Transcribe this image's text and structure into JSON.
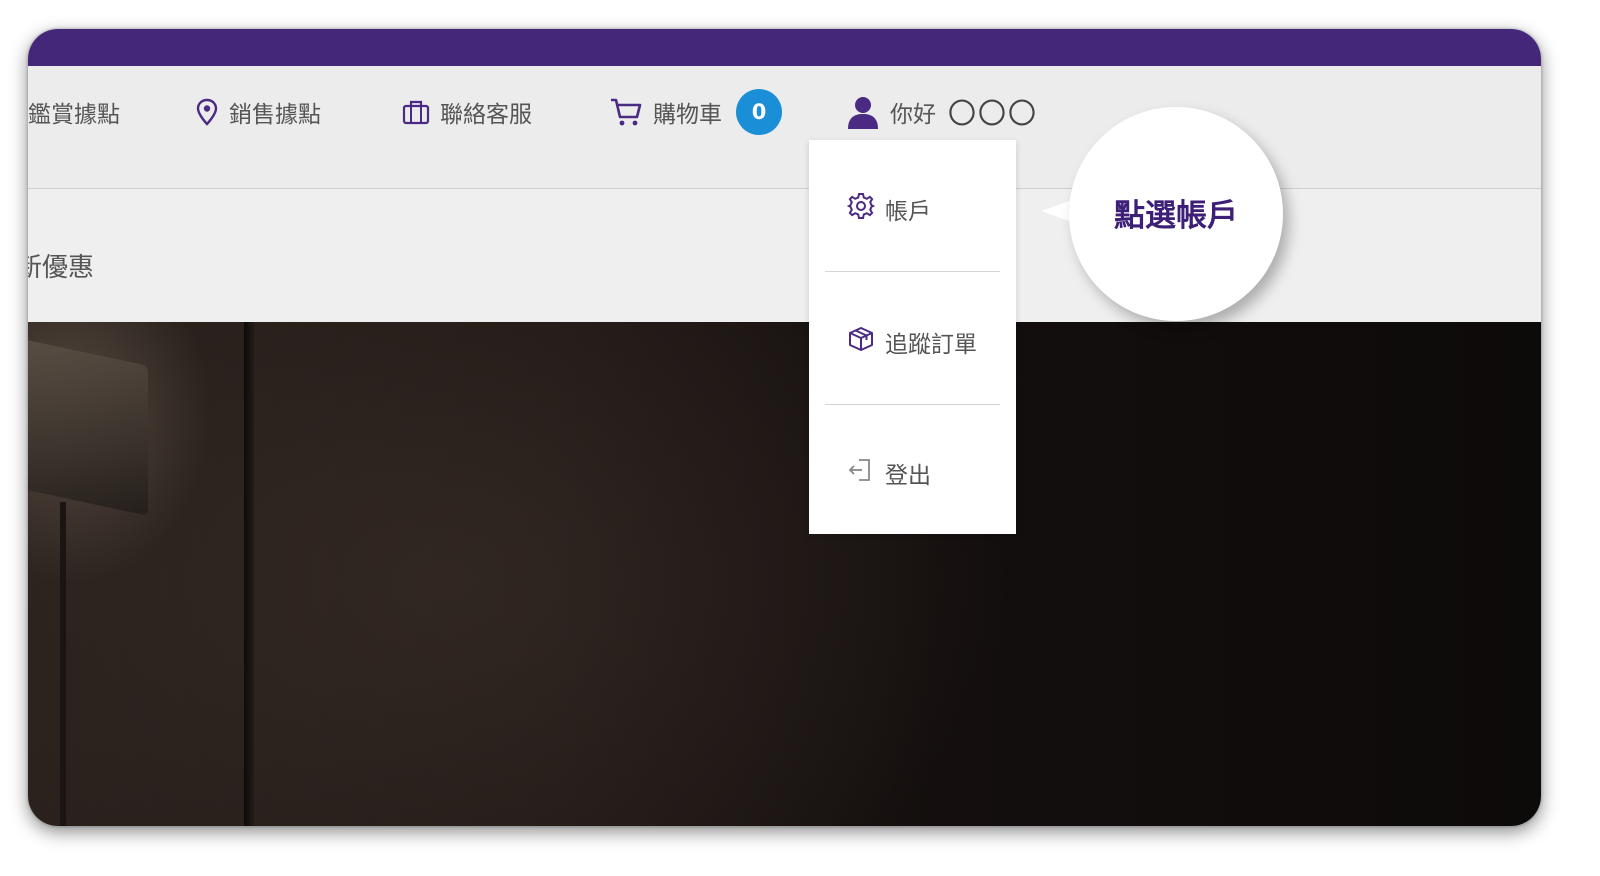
{
  "nav": {
    "items": [
      {
        "label": "鑑賞據點",
        "icon": "none"
      },
      {
        "label": "銷售據點",
        "icon": "location-pin-icon"
      },
      {
        "label": "聯絡客服",
        "icon": "briefcase-icon"
      },
      {
        "label": "購物車",
        "icon": "cart-icon"
      }
    ],
    "cart_count": "0",
    "greeting": "你好",
    "user_name": "〇〇〇"
  },
  "promo": {
    "text": "新優惠"
  },
  "account_menu": {
    "items": [
      {
        "label": "帳戶",
        "icon": "gear-icon"
      },
      {
        "label": "追蹤訂單",
        "icon": "package-icon"
      },
      {
        "label": "登出",
        "icon": "logout-icon"
      }
    ]
  },
  "callout": {
    "text": "點選帳戶"
  },
  "colors": {
    "brand_purple": "#45277a",
    "badge_blue": "#1a8fd8",
    "callout_text": "#3d1f78"
  }
}
